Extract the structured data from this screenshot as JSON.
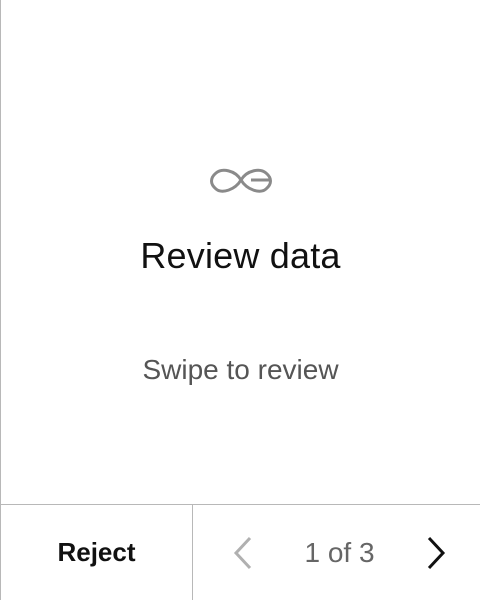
{
  "review": {
    "title": "Review data",
    "subtitle": "Swipe to review"
  },
  "footer": {
    "reject_label": "Reject",
    "page_indicator": "1 of 3",
    "prev_icon": "chevron-left-icon",
    "next_icon": "chevron-right-icon"
  },
  "icons": {
    "logo": "app-logo-icon"
  },
  "colors": {
    "title": "#111111",
    "subtitle": "#555555",
    "disabled_chevron": "#b0b0b0",
    "active_chevron": "#111111",
    "divider": "#b8b8b8",
    "logo": "#8a8a8a"
  }
}
